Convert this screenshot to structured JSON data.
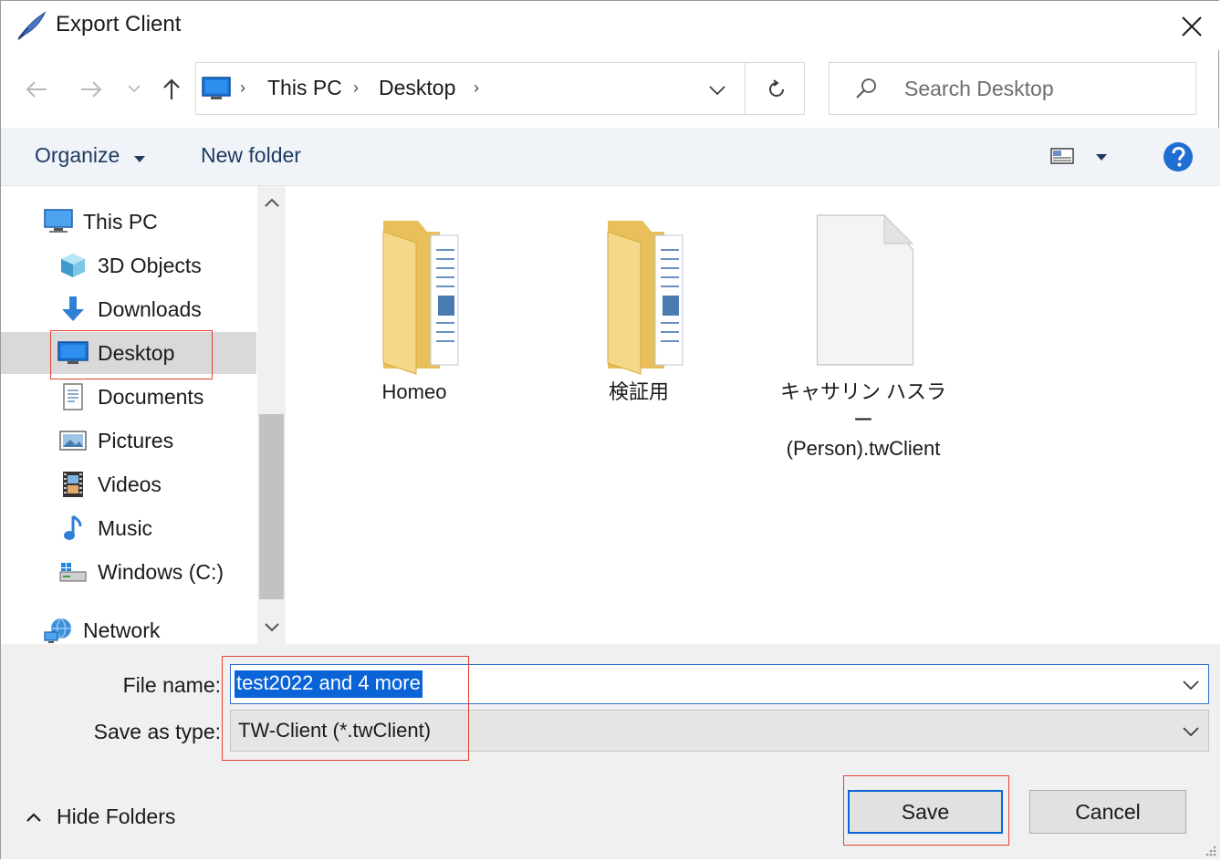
{
  "window": {
    "title": "Export Client",
    "close_glyph": "✕"
  },
  "nav": {
    "breadcrumbs": [
      "This PC",
      "Desktop"
    ],
    "refresh_icon": "refresh-icon",
    "search_placeholder": "Search Desktop"
  },
  "toolbar": {
    "organize_label": "Organize",
    "new_folder_label": "New folder"
  },
  "sidebar": {
    "items": [
      {
        "label": "This PC",
        "icon": "computer-icon"
      },
      {
        "label": "3D Objects",
        "icon": "cube-icon"
      },
      {
        "label": "Downloads",
        "icon": "download-arrow-icon"
      },
      {
        "label": "Desktop",
        "icon": "desktop-icon",
        "selected": true
      },
      {
        "label": "Documents",
        "icon": "document-icon"
      },
      {
        "label": "Pictures",
        "icon": "picture-icon"
      },
      {
        "label": "Videos",
        "icon": "film-icon"
      },
      {
        "label": "Music",
        "icon": "music-note-icon"
      },
      {
        "label": "Windows (C:)",
        "icon": "drive-icon"
      },
      {
        "label": "Network",
        "icon": "network-icon"
      }
    ]
  },
  "files": [
    {
      "name": "Homeo",
      "type": "folder"
    },
    {
      "name": "検証用",
      "type": "folder"
    },
    {
      "name_line1": "キャサリン ハスラー",
      "name_line2": "(Person).twClient",
      "type": "file"
    }
  ],
  "form": {
    "file_name_label": "File name:",
    "file_name_value": "test2022 and 4 more",
    "save_type_label": "Save as type:",
    "save_type_value": "TW-Client (*.twClient)"
  },
  "footer": {
    "hide_folders_label": "Hide Folders",
    "save_label": "Save",
    "cancel_label": "Cancel"
  },
  "colors": {
    "accent": "#0a64d7",
    "highlight_box": "#e34234",
    "toolbar_bg": "#f0f4f9",
    "folder_yellow": "#f3d27a"
  }
}
